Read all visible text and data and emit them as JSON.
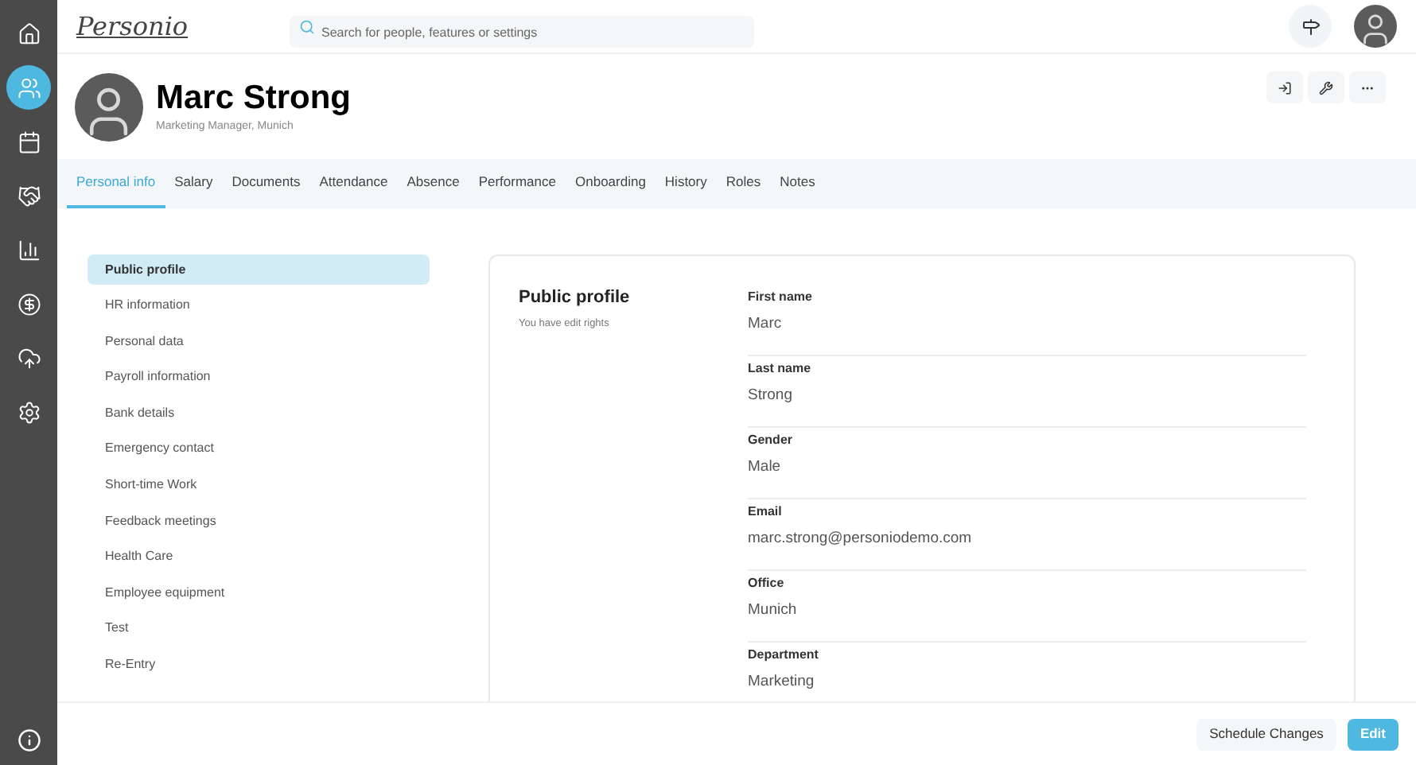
{
  "logo": "Personio",
  "nav": [
    {
      "selected": false
    },
    {
      "selected": true
    },
    {
      "selected": false
    },
    {
      "selected": false
    },
    {
      "selected": false
    },
    {
      "selected": false
    },
    {
      "selected": false
    },
    {
      "selected": false
    }
  ],
  "search": {
    "placeholder": "Search for people, features or settings"
  },
  "profile": {
    "name": "Marc Strong",
    "subtitle": "Marketing Manager, Munich"
  },
  "tabs": [
    {
      "label": "Personal info",
      "selected": true
    },
    {
      "label": "Salary",
      "selected": false
    },
    {
      "label": "Documents",
      "selected": false
    },
    {
      "label": "Attendance",
      "selected": false
    },
    {
      "label": "Absence",
      "selected": false
    },
    {
      "label": "Performance",
      "selected": false
    },
    {
      "label": "Onboarding",
      "selected": false
    },
    {
      "label": "History",
      "selected": false
    },
    {
      "label": "Roles",
      "selected": false
    },
    {
      "label": "Notes",
      "selected": false
    }
  ],
  "sections": [
    {
      "label": "Public profile",
      "selected": true
    },
    {
      "label": "HR information",
      "selected": false
    },
    {
      "label": "Personal data",
      "selected": false
    },
    {
      "label": "Payroll information",
      "selected": false
    },
    {
      "label": "Bank details",
      "selected": false
    },
    {
      "label": "Emergency contact",
      "selected": false
    },
    {
      "label": "Short-time Work",
      "selected": false
    },
    {
      "label": "Feedback meetings",
      "selected": false
    },
    {
      "label": "Health Care",
      "selected": false
    },
    {
      "label": "Employee equipment",
      "selected": false
    },
    {
      "label": "Test",
      "selected": false
    },
    {
      "label": "Re-Entry",
      "selected": false
    }
  ],
  "card": {
    "title": "Public profile",
    "subtitle": "You have edit rights",
    "fields": [
      {
        "label": "First name",
        "value": "Marc"
      },
      {
        "label": "Last name",
        "value": "Strong"
      },
      {
        "label": "Gender",
        "value": "Male"
      },
      {
        "label": "Email",
        "value": "marc.strong@personiodemo.com"
      },
      {
        "label": "Office",
        "value": "Munich"
      },
      {
        "label": "Department",
        "value": "Marketing"
      }
    ]
  },
  "footer": {
    "buttons": [
      "Schedule Changes",
      "Edit"
    ]
  }
}
